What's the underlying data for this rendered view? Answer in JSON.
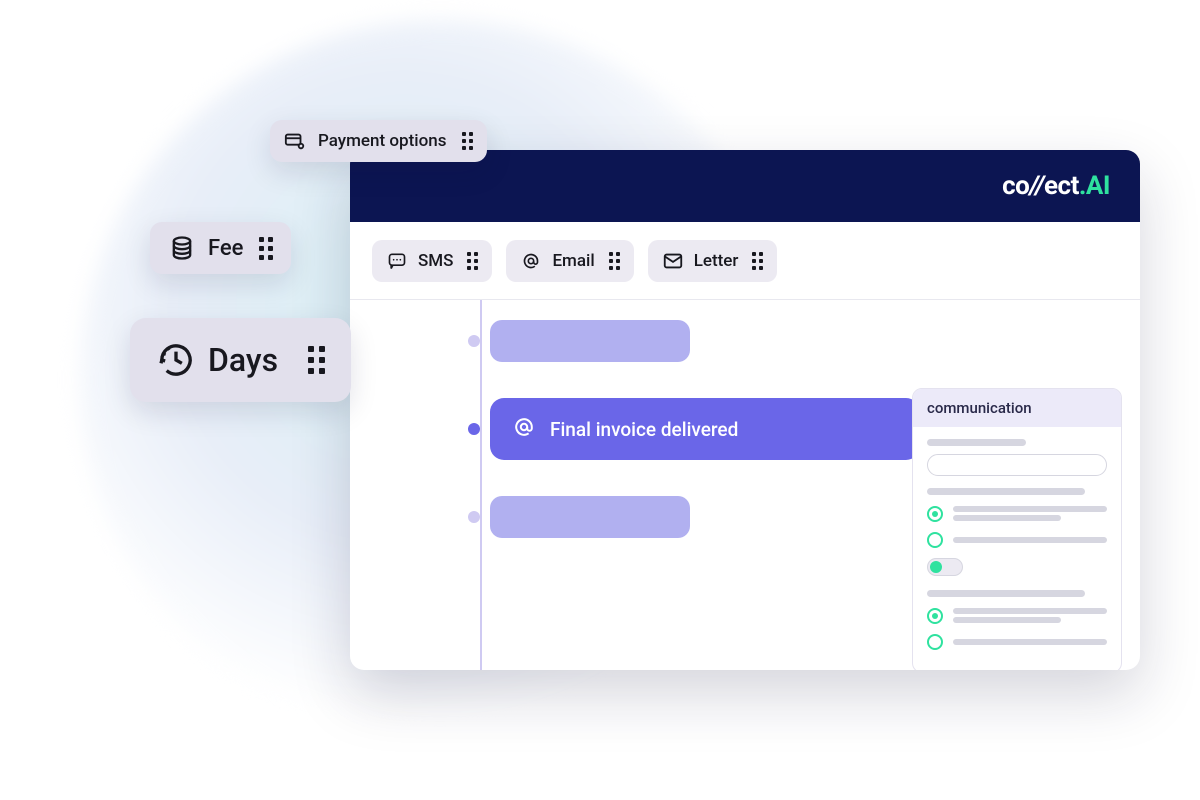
{
  "brand": {
    "name_part1": "co",
    "name_slash": "//",
    "name_part2": "ect",
    "dot": ".",
    "suffix": "AI"
  },
  "toolbar": {
    "sms_label": "SMS",
    "email_label": "Email",
    "letter_label": "Letter"
  },
  "timeline": {
    "main_event_label": "Final invoice delivered"
  },
  "side_panel": {
    "title": "communication"
  },
  "floating": {
    "payment_label": "Payment options",
    "fee_label": "Fee",
    "days_label": "Days"
  },
  "icons": {
    "sms": "sms-icon",
    "at": "at-icon",
    "envelope": "envelope-icon",
    "card": "card-settings-icon",
    "coins": "coins-icon",
    "clock": "clock-history-icon",
    "grip": "drag-grip-icon"
  }
}
